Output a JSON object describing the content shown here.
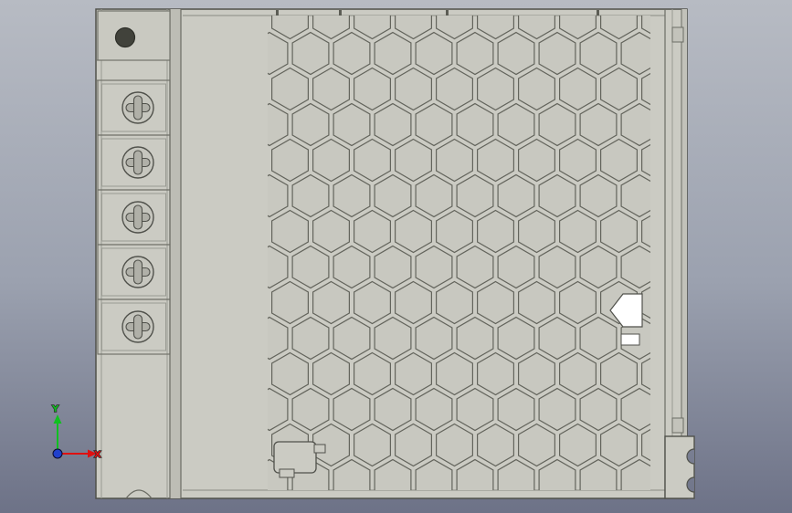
{
  "viewport": {
    "background_top": "#b7bbc3",
    "background_mid": "#9ba1af",
    "background_bottom": "#6d7287",
    "part_fill": "#cbcbc3",
    "part_fill_dark": "#bdbdb5",
    "part_outline": "#50514b",
    "inner_line": "#6b6c64",
    "bevel_line": "#9a9b93",
    "hex_fill": "#c8c8c0",
    "hex_outline": "#63645c",
    "hole_fill": "#41423b",
    "highlight_fill": "#ffffff",
    "terminal_screws": 5,
    "vent_pattern": "hexagonal"
  },
  "axis_triad": {
    "x_label": "X",
    "y_label": "Y",
    "x_color": "#e01010",
    "y_color": "#10c020",
    "z_color": "#2040cc"
  }
}
